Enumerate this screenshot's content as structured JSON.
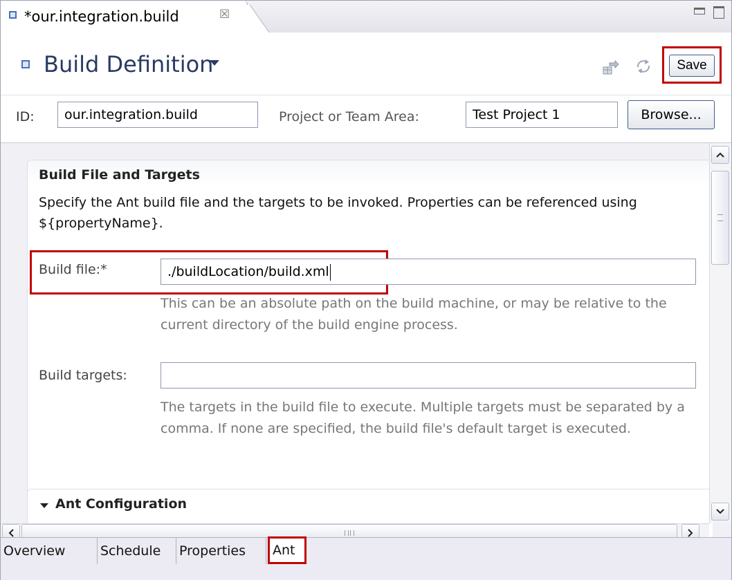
{
  "editor_tab": {
    "title": "*our.integration.build",
    "close_glyph": "☒"
  },
  "header": {
    "title": "Build Definition",
    "save_label": "Save"
  },
  "id_row": {
    "id_label": "ID:",
    "id_value": "our.integration.build",
    "project_label": "Project or Team Area:",
    "project_value": "Test Project 1",
    "browse_label": "Browse..."
  },
  "build_file_section": {
    "title": "Build File and Targets",
    "description": "Specify the Ant build file and the targets to be invoked. Properties can be referenced using ${propertyName}.",
    "build_file_label": "Build file:*",
    "build_file_value": "./buildLocation/build.xml",
    "build_file_help": "This can be an absolute path on the build machine, or may be relative to the current directory of the build engine process.",
    "build_targets_label": "Build targets:",
    "build_targets_value": "",
    "build_targets_help": "The targets in the build file to execute. Multiple targets must be separated by a comma. If none are specified, the build file's default target is executed."
  },
  "ant_section": {
    "title": "Ant Configuration"
  },
  "page_tabs": {
    "overview": "Overview",
    "schedule": "Schedule",
    "properties": "Properties",
    "ant": "Ant",
    "active": "Ant"
  },
  "colors": {
    "highlight": "#c00000",
    "header_title": "#2b3a63",
    "help_text": "#777777"
  }
}
